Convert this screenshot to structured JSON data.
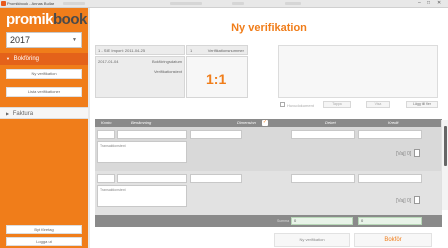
{
  "window": {
    "title": "Promikbook - Annas Bullar",
    "controls": [
      "–",
      "□",
      "✕"
    ]
  },
  "sidebar": {
    "logo_part1": "promik",
    "logo_part2": "book",
    "year": "2017",
    "sections": [
      {
        "label": "Bokföring",
        "items": [
          "Ny verifikation",
          "Lista verifikationer"
        ]
      },
      {
        "label": "Faktura"
      }
    ],
    "bottom_buttons": [
      "Byt företag",
      "Logga ut"
    ]
  },
  "page": {
    "title": "Ny verifikation",
    "series_row": {
      "left": "1 - SIE Import: 2011-04-25",
      "num": "1",
      "label": "Verifikationsnummer"
    },
    "date_row": {
      "date": "2017-01-04",
      "label": "Bokföringsdatum"
    },
    "text_label": "Verifikationstext",
    "ver_number": "1:1",
    "attach_checkbox_label": "Huvudokument",
    "small_buttons": [
      "Tappa",
      "Visa",
      "Lägg till fler"
    ]
  },
  "table": {
    "headers": {
      "konto": "Konto",
      "benamning": "Benämning",
      "dimension": "Dimension",
      "debet": "Debet",
      "kredit": "Kredit"
    },
    "note_label": "Transaktionstext",
    "rows": [
      {
        "vaj_label": "[Vaj] 0]"
      },
      {
        "vaj_label": "[Vaj] 0]"
      }
    ],
    "sum_label": "Summa",
    "sum_debet": "0",
    "sum_kredit": "0"
  },
  "actions": {
    "new_label": "Ny verifikation",
    "book_label": "Bokför"
  },
  "colors": {
    "accent": "#f07d1a",
    "accent_dark": "#e4621a"
  }
}
